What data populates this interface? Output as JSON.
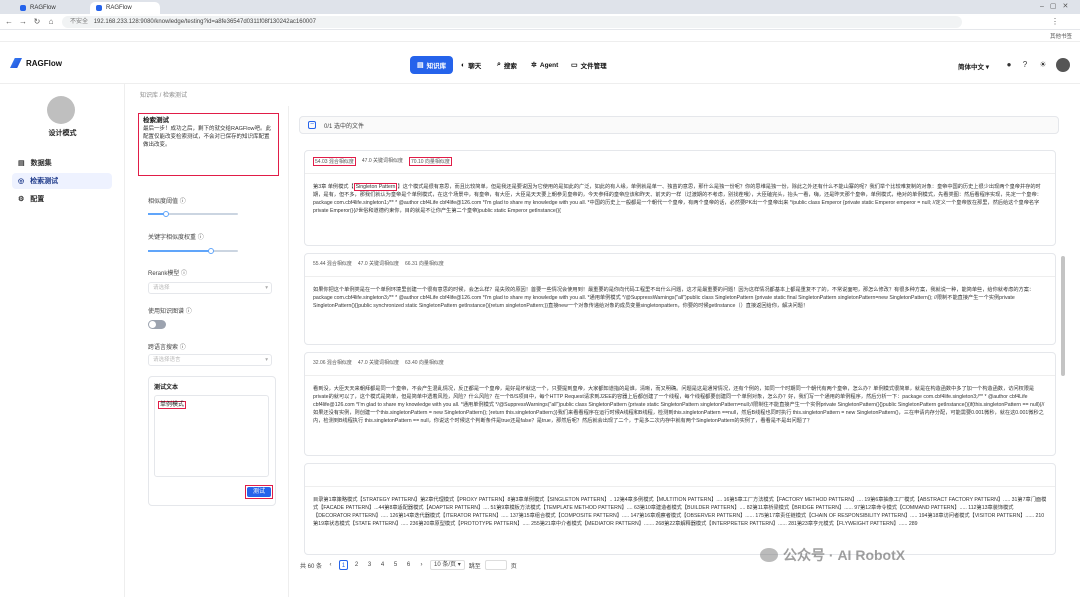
{
  "browser": {
    "tabs": [
      {
        "label": "RAGFlow"
      },
      {
        "label": "RAGFlow"
      }
    ],
    "not_secure": "不安全",
    "url": "192.168.233.128:9080/knowledge/testing?id=a8fe36547d0311f08f130242ac160007",
    "bookmark_right": "其他书签"
  },
  "header": {
    "logo_text": "RAGFlow",
    "nav": [
      {
        "label": "知识库",
        "icon": "database-icon"
      },
      {
        "label": "聊天",
        "icon": "chat-icon"
      },
      {
        "label": "搜索",
        "icon": "search-icon"
      },
      {
        "label": "Agent",
        "icon": "agent-icon"
      },
      {
        "label": "文件管理",
        "icon": "file-icon"
      }
    ],
    "language": "简体中文",
    "accent": "#2563eb"
  },
  "sidebar": {
    "kb_title": "设计模式",
    "items": [
      {
        "label": "数据集"
      },
      {
        "label": "检索测试"
      },
      {
        "label": "配置"
      }
    ]
  },
  "breadcrumb": {
    "root": "知识库",
    "current": "检索测试"
  },
  "settings": {
    "desc_title": "检索测试",
    "desc_text": "最后一步！成功之后，剩下的就交给RAGFlow吧。此配置仅能改变检索测试，不会对已保存的知识库配置做出改变。",
    "similarity_label": "相似度阈值",
    "similarity_value": 0.2,
    "keyword_weight_label": "关键字相似度权重",
    "keyword_weight_value": 0.7,
    "rerank_label": "Rerank模型",
    "rerank_placeholder": "请选择",
    "kg_label": "使用知识图谱",
    "tags_label": "跨语言搜索",
    "tags_placeholder": "请选择语言",
    "test_text_label": "测试文本",
    "test_text_value": "单例模式",
    "test_button": "测试"
  },
  "results": {
    "file_summary": "0/1 选中的文件",
    "cards": [
      {
        "hybrid": "54.03 混合相似度",
        "term": "47.0 关键词相似度",
        "vector": "70.10 向量相似度",
        "text_pre": "第3章 单例模式【",
        "text_hl": "Singleton Pattern",
        "text_post": "】这个模式是很有意思，而且比较简单，但是我还是要说因为它使用的是如此的广泛，如此的有人缘，单例就是单一、独苗的意思，那什么是独一份呢？你的思维是独一份，除此之外还有什么不能山寨的呢？我们举个比较难复制的对象：皇帝中国的历史上很少出现两个皇帝并存的时期，是有，但不多，那我们就认为皇帝是个单例模式，在这个场景中，有皇帝，有大臣，大臣是天天要上朝参见皇帝的，今天参拜的皇帝应该和昨天、前天的一样（过渡期的不考虑，别找茬哦），大臣磕完头，抬头一看，嗨，还是昨天那个皇帝，单例模式，绝对的单例模式，先看类图：然后看程序实现，先定一个皇帝：package com.cbf4life.singleton1;/** * @author cbf4Life cbf4life@126.com *I'm glad to share my knowledge with you all. *中国的历史上一般都是一个朝代一个皇帝，有两个皇帝的话，必然要PK出一个皇帝出来 */public class Emperor {private static Emperor emperor = null; //定义一个皇帝放在那里，然后给这个皇帝名字private Emperor(){//世俗和道德约束你，目的就是不让你产生第二个皇帝}public static Emperor getInstance(){"
      },
      {
        "hybrid": "55.44 混合相似度",
        "term": "47.0 关键词相似度",
        "vector": "66.31 向量相似度",
        "text_pre": "",
        "text_hl": "",
        "text_post": "如果你把这个单例类是在一个单例环境里创建一个很有意思的时候，会怎么样？是失败的原因！首要一些情况会使用到！最重要的是你向代码工程里不出什么问题，这才是最重要的问题！因为这样情况都基本上都是重复不了的，不常说面吧，那怎么修改？有很多种方案，我就说一种，能简单些，给你就考虑的方案：package com.cbf4life.singleton3;/** * @author cbf4Life cbf4life@126.com *I'm glad to share my knowledge with you all. *通用单例模式 */@SuppressWarnings(\"all\")public class SingletonPattern {private static final SingletonPattern singletonPattern=new SingletonPattern(); //限制不能直接产生一个实例private SingletonPattern(){}public synchronized static SingletonPattern getInstance(){return singletonPattern;}}直接new一个对象传递给对象的成员变量singletonpattern，你要的时候getInstance（）直接返回给你，解决问题！"
      },
      {
        "hybrid": "32.06 混合相似度",
        "term": "47.0 关键词相似度",
        "vector": "63.40 向量相似度",
        "text_pre": "",
        "text_hl": "",
        "text_post": "看到没，大臣天天来朝拜都是同一个皇帝，不会产生混乱情况，反正都是一个皇帝，是好是坏就这一个，只要提到皇帝，大家都知道指的是谁，清晰，而又明确。问题是这是通常情况，还有个例的，如同一个时期同一个朝代有两个皇帝，怎么办？单例模式很简单，就是在构造函数中多了加一个构造函数，访问权限是private的就可以了，这个模式是简单，但是简单中透着风险，风险？什么风险？在一个B/S项目中，每个HTTP Request请求到J2EE的容器上后都创建了一个线程，每个线程都要创建同一个单例对象，怎么办？好，我们写一个通用的单例程序，然后分析一下：package com.cbf4life.singleton3;/** * @author cbf4Life cbf4life@126.com *I'm glad to share my knowledge with you all. *通用单例模式 */@SuppressWarnings(\"all\")public class SingletonPattern {private static SingletonPattern singletonPattern=null;//限制住不能直接产生一个实例private SingletonPattern(){}public SingletonPattern getInstance(){if(this.singletonPattern == null){//如果还没有实例，则创建一个this.singletonPattern = new SingletonPattern(); }return this.singletonPattern;}}我们来看看程序在运行时候A线程和B线程，检测到this.singletonPattern ==null，然后B线程也同时执行 this.singletonPattern = new SingletonPattern()，三在申请内存分配，可能需要0.001微秒，就在这0.001微秒之内，检测到B线程执行 this.singletonPattern == null，你说这个时候这个判断条件是true还是false？是true，那然后呢？然后就会出现了二个，于是多二次内存中就有两个SingletonPattern的实例了，看看是不是出问题了？"
      },
      {
        "hybrid": "",
        "term": "",
        "vector": "",
        "text_pre": "",
        "text_hl": "",
        "text_post": "目录第1章策略模式【STRATEGY PATTERN】第2章代理模式【PROXY PATTERN】8第3章单例模式【SINGLETON PATTERN】.. 12第4章多例模式【MULTITION PATTERN】.... 16第5章工厂方法模式【FACTORY METHOD PATTERN】.... 19第6章抽象工厂模式【ABSTRACT FACTORY PATTERN】..... 31第7章门面模式【FACADE PATTERN】...44第8章适配器模式【ADAPTER PATTERN】.... 51第9章模板方法模式【TEMPLATE METHOD PATTERN】.... 63第10章建造者模式【BUILDER PATTERN】.... 82第11章桥梁模式【BRIDGE PATTERN】...... 97第12章命令模式【COMMAND PATTERN】..... 112第13章装饰模式【DECORATOR PATTERN】..... 126第14章迭代器模式【ITERATOR PATTERN】..... 137第15章组合模式【COMPOSITE PATTERN】..... 147第16章观察者模式【OBSERVER PATTERN】...... 175第17章责任链模式【CHAIN OF RESPONSIBILITY PATTERN】..... 194第18章访问者模式【VISITOR PATTERN】...... 210第19章状态模式【STATE PATTERN】..... 236第20章原型模式【PROTOTYPE PATTERN】..... 255第21章中介者模式【MEDIATOR PATTERN】....... 268第22章解释器模式【INTERPRETER PATTERN】...... 281第23章亨元模式【FLYWEIGHT PATTERN】...... 289"
      }
    ],
    "pager": {
      "total": "共 60 条",
      "pages": [
        "1",
        "2",
        "3",
        "4",
        "5",
        "6"
      ],
      "current": "1",
      "per_page": "10 条/页",
      "goto_label": "跳至",
      "goto_suffix": "页"
    }
  },
  "watermark": "公众号 · AI RobotX"
}
